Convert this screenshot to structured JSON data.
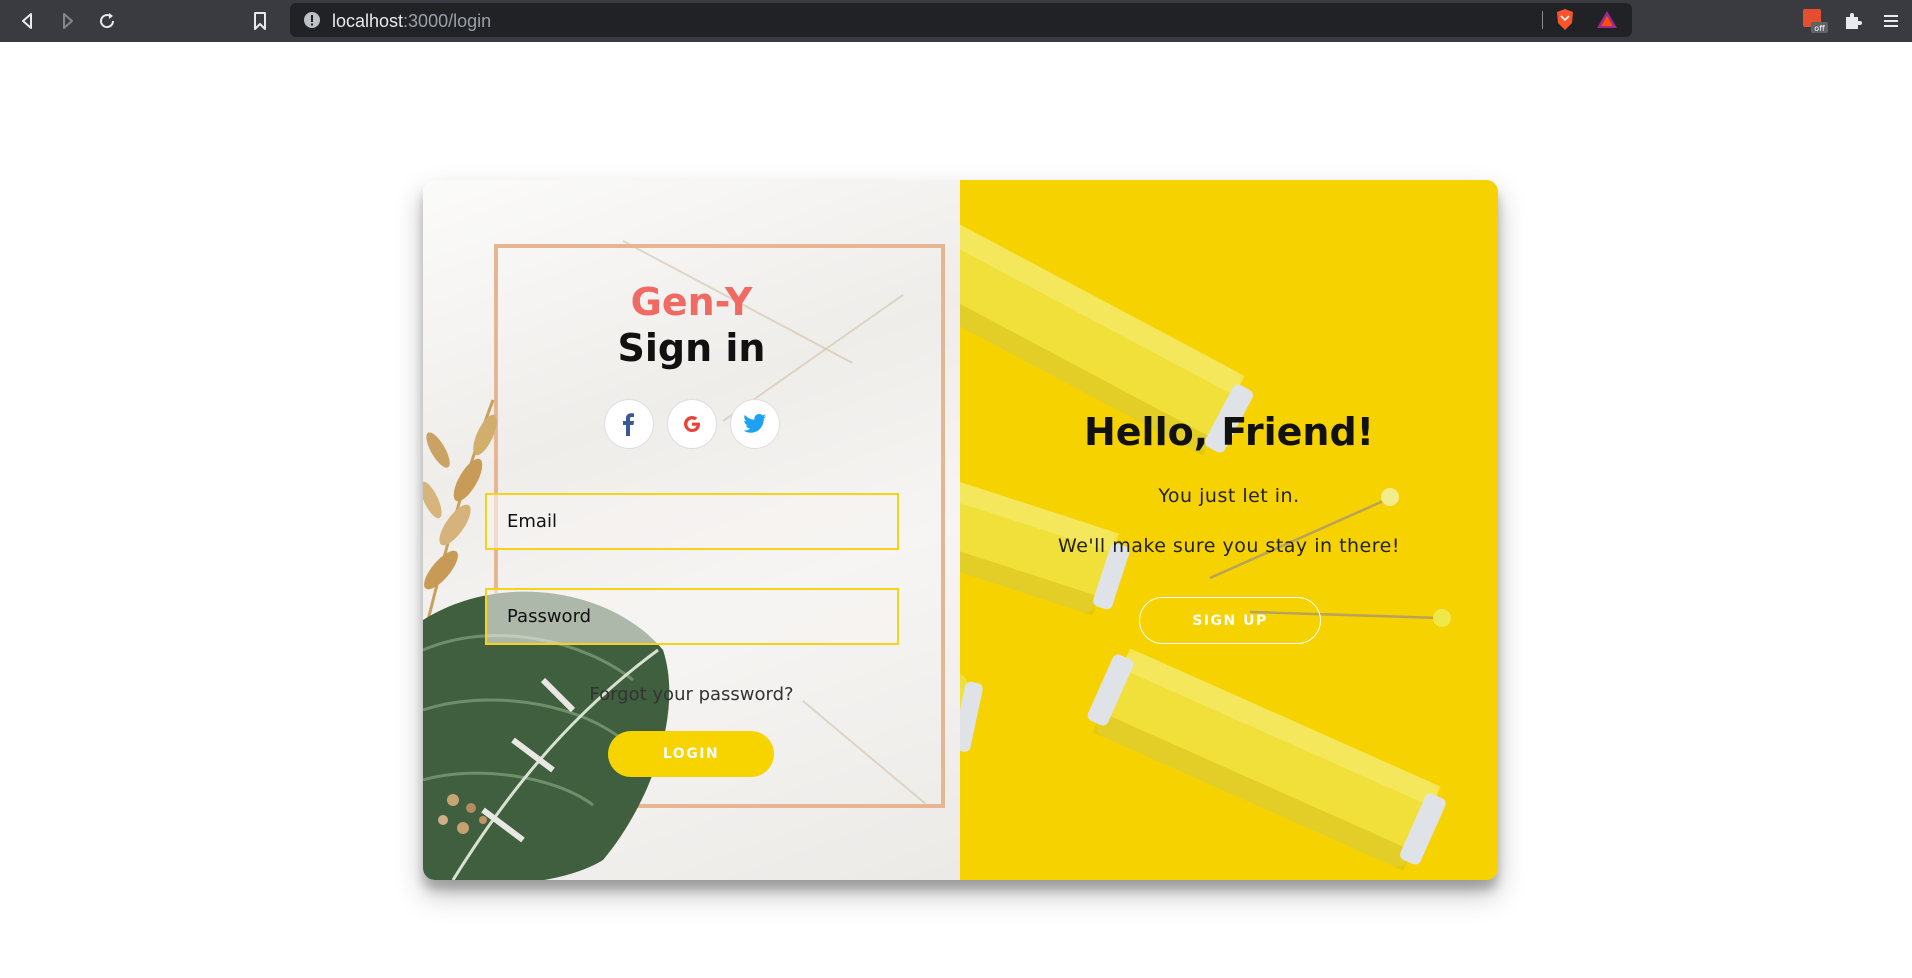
{
  "browser": {
    "url_host": "localhost",
    "url_path": ":3000/login"
  },
  "login": {
    "brand": "Gen-Y",
    "title": "Sign in",
    "social": [
      {
        "name": "facebook-icon",
        "glyph": "f",
        "color": "#3b5998"
      },
      {
        "name": "google-icon",
        "glyph": "G",
        "color": "#ea4335"
      },
      {
        "name": "twitter-icon",
        "glyph": "twitter",
        "color": "#1da1f2"
      }
    ],
    "email_placeholder": "Email",
    "password_placeholder": "Password",
    "forgot_text": "Forgot your password?",
    "login_label": "LOGIN"
  },
  "overlay": {
    "title": "Hello, Friend!",
    "line1": "You just let in.",
    "line2": "We'll make sure you stay in there!",
    "signup_label": "SIGN UP"
  },
  "colors": {
    "brand": "#f06a63",
    "accent": "#f7d300",
    "field_border": "#f7d21a",
    "overlay_bg": "#f6d200"
  }
}
